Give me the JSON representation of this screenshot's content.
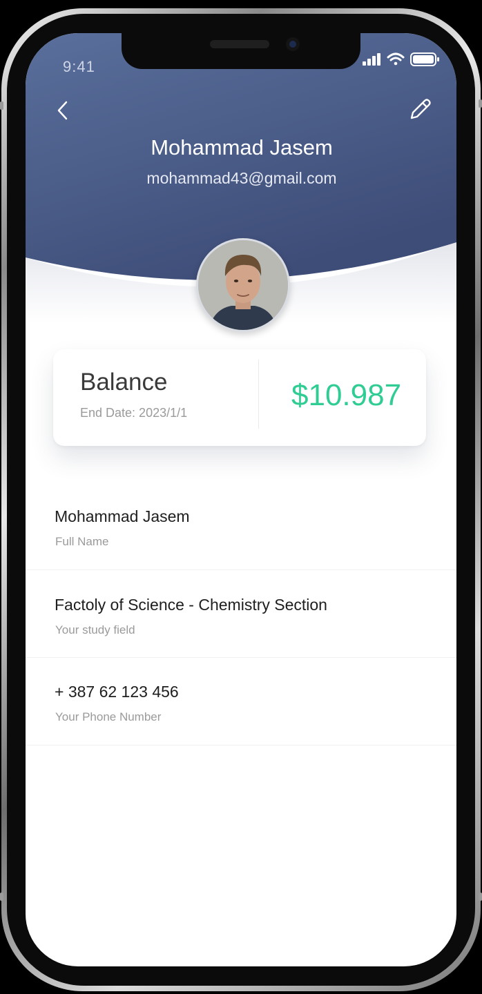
{
  "status_bar": {
    "time": "9:41"
  },
  "header": {
    "name": "Mohammad Jasem",
    "email": "mohammad43@gmail.com",
    "gradient_start": "#5a6f9c",
    "gradient_end": "#3e4d78"
  },
  "balance": {
    "title": "Balance",
    "end_date": "End Date: 2023/1/1",
    "amount": "$10.987",
    "amount_color": "#2fcc93"
  },
  "fields": [
    {
      "value": "Mohammad Jasem",
      "label": "Full Name"
    },
    {
      "value": "Factoly of Science - Chemistry Section",
      "label": "Your study field"
    },
    {
      "value": "+ 387 62 123 456",
      "label": "Your Phone Number"
    }
  ],
  "icons": {
    "back": "chevron-left-icon",
    "edit": "pencil-icon",
    "signal": "cellular-signal-icon",
    "wifi": "wifi-icon",
    "battery": "battery-icon"
  }
}
